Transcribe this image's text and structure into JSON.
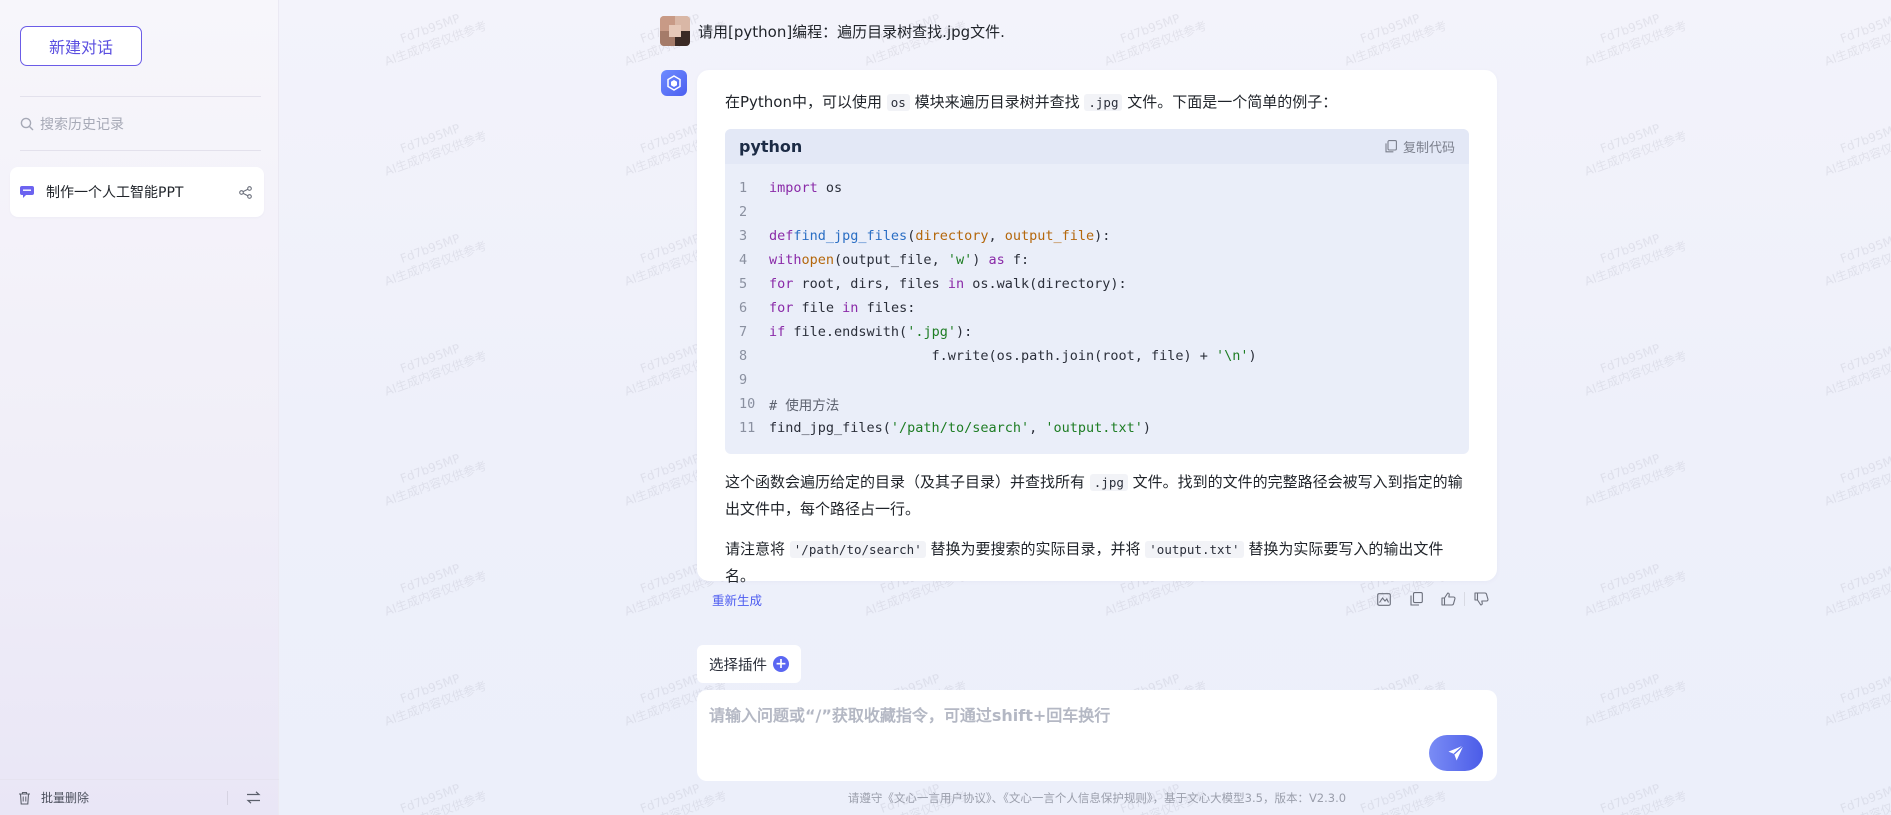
{
  "sidebar": {
    "new_chat_label": "新建对话",
    "search_placeholder": "搜索历史记录",
    "history": [
      {
        "title": "制作一个人工智能PPT"
      }
    ],
    "batch_delete_label": "批量删除"
  },
  "conversation": {
    "user_message": "请用[python]编程：遍历目录树查找.jpg文件.",
    "answer": {
      "intro_parts": [
        "在Python中，可以使用 ",
        "os",
        " 模块来遍历目录树并查找 ",
        ".jpg",
        " 文件。下面是一个简单的例子："
      ],
      "code": {
        "language": "python",
        "copy_label": "复制代码",
        "line_numbers": [
          "1",
          "2",
          "3",
          "4",
          "5",
          "6",
          "7",
          "8",
          "9",
          "10",
          "11"
        ]
      },
      "explain_parts": [
        "这个函数会遍历给定的目录（及其子目录）并查找所有 ",
        ".jpg",
        " 文件。找到的文件的完整路径会被写入到指定的输出文件中，每个路径占一行。"
      ],
      "note_parts": [
        "请注意将 ",
        "'/path/to/search'",
        " 替换为要搜索的实际目录，并将 ",
        "'output.txt'",
        " 替换为实际要写入的输出文件名。"
      ]
    },
    "regenerate_label": "重新生成"
  },
  "composer": {
    "plugin_label": "选择插件",
    "plugin_plus": "+",
    "placeholder": "请输入问题或“/”获取收藏指令，可通过shift+回车换行"
  },
  "footer": "请遵守《文心一言用户协议》、《文心一言个人信息保护规则》，基于文心大模型3.5，版本：V2.3.0",
  "watermark": {
    "line1": "Fd7b95MP",
    "line2": "AI生成内容仅供参考"
  },
  "colors": {
    "accent": "#5b4fe0",
    "link": "#4d5cf0",
    "code_bg": "#eaeef9"
  }
}
